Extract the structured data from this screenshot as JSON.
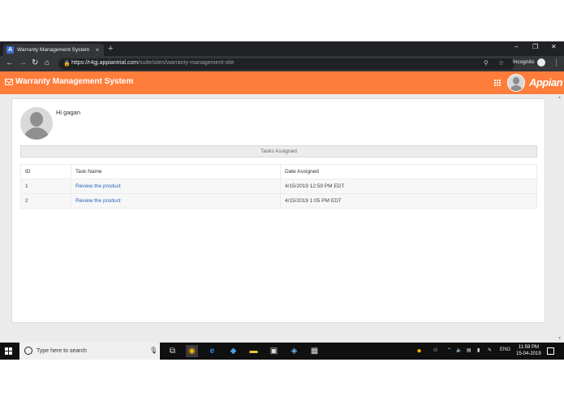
{
  "browser": {
    "tab_title": "Warranty Management System",
    "url_host": "https://r4gj.appiantrial.com",
    "url_path": "/suite/sites/warranty-management-site",
    "incognito_label": "Incognito"
  },
  "app": {
    "title": "Warranty Management System",
    "logo_text": "Appian",
    "header_color": "#ff7d3b"
  },
  "page": {
    "greeting": "Hi gagan",
    "section_title": "Tasks Assigned",
    "columns": [
      "ID",
      "Task Name",
      "Date Assigned"
    ],
    "rows": [
      {
        "id": "1",
        "task": "Review the product",
        "date": "4/15/2019 12:59 PM EDT"
      },
      {
        "id": "2",
        "task": "Review the product",
        "date": "4/15/2019 1:05 PM EDT"
      }
    ]
  },
  "taskbar": {
    "search_placeholder": "Type here to search",
    "language": "ENG",
    "time": "11:59 PM",
    "date": "15-04-2019"
  }
}
